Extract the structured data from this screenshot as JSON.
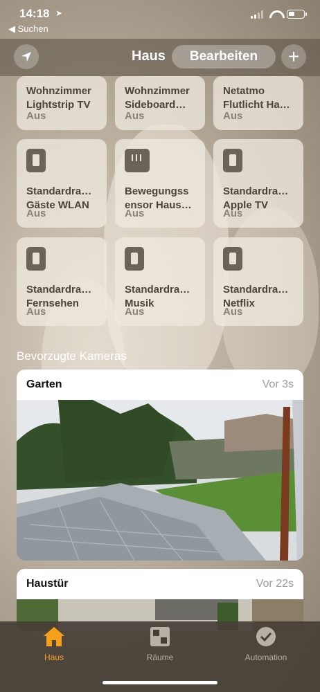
{
  "status_bar": {
    "time": "14:18",
    "back_label": "◀ Suchen"
  },
  "nav": {
    "title": "Haus",
    "edit_label": "Bearbeiten",
    "add_label": "+"
  },
  "tiles": [
    {
      "name": "Wohnzimmer Lightstrip TV",
      "line1": "Wohnzimmer",
      "line2": "Lightstrip TV",
      "state": "Aus",
      "icon": "light-icon"
    },
    {
      "name": "Wohnzimmer Sideboard…",
      "line1": "Wohnzimmer",
      "line2": "Sideboard…",
      "state": "Aus",
      "icon": "light-icon"
    },
    {
      "name": "Netatmo Flutlicht Ha…",
      "line1": "Netatmo",
      "line2": "Flutlicht Ha…",
      "state": "Aus",
      "icon": "light-icon"
    },
    {
      "name": "Standardra… Gäste WLAN",
      "line1": "Standardra…",
      "line2": "Gäste WLAN",
      "state": "Aus",
      "icon": "switch-icon"
    },
    {
      "name": "Bewegungssensor Haus…",
      "line1": "Bewegungss",
      "line2": "ensor Haus…",
      "state": "Aus",
      "icon": "motion-sensor-icon"
    },
    {
      "name": "Standardra… Apple TV",
      "line1": "Standardra…",
      "line2": "Apple TV",
      "state": "Aus",
      "icon": "switch-icon"
    },
    {
      "name": "Standardra… Fernsehen",
      "line1": "Standardra…",
      "line2": "Fernsehen",
      "state": "Aus",
      "icon": "switch-icon"
    },
    {
      "name": "Standardra… Musik",
      "line1": "Standardra…",
      "line2": "Musik",
      "state": "Aus",
      "icon": "switch-icon"
    },
    {
      "name": "Standardra… Netflix",
      "line1": "Standardra…",
      "line2": "Netflix",
      "state": "Aus",
      "icon": "switch-icon"
    }
  ],
  "cameras_section": {
    "title": "Bevorzugte Kameras"
  },
  "cameras": [
    {
      "name": "Garten",
      "time": "Vor 3s"
    },
    {
      "name": "Haustür",
      "time": "Vor 22s"
    }
  ],
  "tabbar": {
    "items": [
      {
        "label": "Haus",
        "icon": "house-icon",
        "active": true
      },
      {
        "label": "Räume",
        "icon": "rooms-icon",
        "active": false
      },
      {
        "label": "Automation",
        "icon": "automation-icon",
        "active": false
      }
    ]
  },
  "colors": {
    "accent": "#f7a11a",
    "tile_bg": "#eee8de",
    "tabbar_bg": "#463e36"
  }
}
